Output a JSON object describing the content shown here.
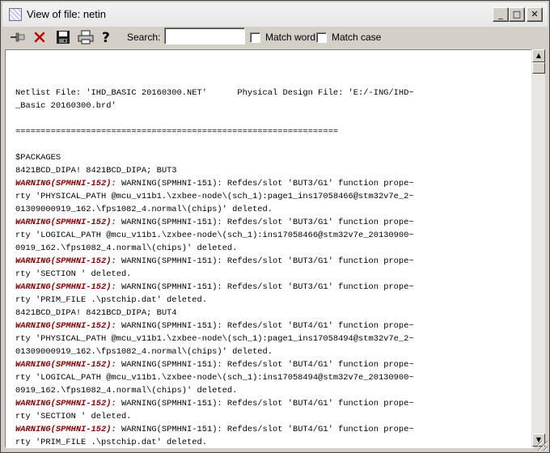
{
  "window": {
    "title": "View of file: netin",
    "controls": {
      "minimize": "_",
      "maximize": "□",
      "close": "✕"
    }
  },
  "toolbar": {
    "buttons": [
      {
        "name": "pin-button",
        "icon": "pin-icon"
      },
      {
        "name": "close-file-button",
        "icon": "red-x-icon"
      },
      {
        "name": "save-button",
        "icon": "floppy-disk-icon"
      },
      {
        "name": "print-button",
        "icon": "printer-icon"
      },
      {
        "name": "help-button",
        "icon": "help-question-icon"
      }
    ],
    "search_label": "Search:",
    "search_value": "",
    "match_word_label": "Match word",
    "match_word_checked": false,
    "match_case_label": "Match case",
    "match_case_checked": false
  },
  "content": {
    "lines": [
      {
        "text": "Netlist File: 'IHD_BASIC 20160300.NET'      Physical Design File: 'E:/-ING/IHD~"
      },
      {
        "text": "_Basic 20160300.brd'"
      },
      {
        "text": ""
      },
      {
        "text": "================================================================"
      },
      {
        "text": ""
      },
      {
        "text": "$PACKAGES"
      },
      {
        "text": "8421BCD_DIPA! 8421BCD_DIPA; BUT3"
      },
      {
        "warn": "WARNING(SPMHNI-152):",
        "text": " WARNING(SPMHNI-151): Refdes/slot 'BUT3/G1' function prope~"
      },
      {
        "text": "rty 'PHYSICAL_PATH @mcu_v11b1.\\zxbee-node\\(sch_1):page1_ins17058466@stm32v7e_2~"
      },
      {
        "text": "01309000919_162.\\fps1082_4.normal\\(chips)' deleted."
      },
      {
        "warn": "WARNING(SPMHNI-152):",
        "text": " WARNING(SPMHNI-151): Refdes/slot 'BUT3/G1' function prope~"
      },
      {
        "text": "rty 'LOGICAL_PATH @mcu_v11b1.\\zxbee-node\\(sch_1):ins17058466@stm32v7e_20130900~"
      },
      {
        "text": "0919_162.\\fps1082_4.normal\\(chips)' deleted."
      },
      {
        "warn": "WARNING(SPMHNI-152):",
        "text": " WARNING(SPMHNI-151): Refdes/slot 'BUT3/G1' function prope~"
      },
      {
        "text": "rty 'SECTION ' deleted."
      },
      {
        "warn": "WARNING(SPMHNI-152):",
        "text": " WARNING(SPMHNI-151): Refdes/slot 'BUT3/G1' function prope~"
      },
      {
        "text": "rty 'PRIM_FILE .\\pstchip.dat' deleted."
      },
      {
        "text": "8421BCD_DIPA! 8421BCD_DIPA; BUT4"
      },
      {
        "warn": "WARNING(SPMHNI-152):",
        "text": " WARNING(SPMHNI-151): Refdes/slot 'BUT4/G1' function prope~"
      },
      {
        "text": "rty 'PHYSICAL_PATH @mcu_v11b1.\\zxbee-node\\(sch_1):page1_ins17058494@stm32v7e_2~"
      },
      {
        "text": "01309000919_162.\\fps1082_4.normal\\(chips)' deleted."
      },
      {
        "warn": "WARNING(SPMHNI-152):",
        "text": " WARNING(SPMHNI-151): Refdes/slot 'BUT4/G1' function prope~"
      },
      {
        "text": "rty 'LOGICAL_PATH @mcu_v11b1.\\zxbee-node\\(sch_1):ins17058494@stm32v7e_20130900~"
      },
      {
        "text": "0919_162.\\fps1082_4.normal\\(chips)' deleted."
      },
      {
        "warn": "WARNING(SPMHNI-152):",
        "text": " WARNING(SPMHNI-151): Refdes/slot 'BUT4/G1' function prope~"
      },
      {
        "text": "rty 'SECTION ' deleted."
      },
      {
        "warn": "WARNING(SPMHNI-152):",
        "text": " WARNING(SPMHNI-151): Refdes/slot 'BUT4/G1' function prope~"
      },
      {
        "text": "rty 'PRIM_FILE .\\pstchip.dat' deleted."
      }
    ]
  },
  "scrollbar": {
    "up_arrow": "▲",
    "down_arrow": "▼"
  },
  "colors": {
    "warning_tag": "#8b0000",
    "window_bg": "#d4d0c8"
  }
}
